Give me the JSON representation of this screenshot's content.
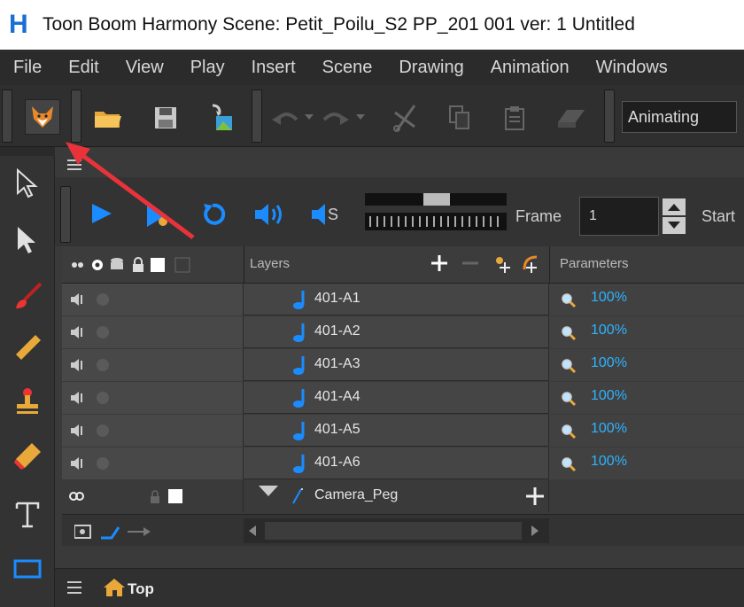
{
  "titlebar": {
    "app_icon": "H",
    "title": "Toon Boom Harmony Scene: Petit_Poilu_S2 PP_201 001 ver: 1 Untitled"
  },
  "menu": [
    "File",
    "Edit",
    "View",
    "Play",
    "Insert",
    "Scene",
    "Drawing",
    "Animation",
    "Windows"
  ],
  "toolbar": {
    "icons": [
      "fox-mascot-icon",
      "open-folder-icon",
      "save-icon",
      "import-image-icon",
      "undo-icon",
      "redo-icon",
      "cut-icon",
      "copy-icon",
      "paste-icon",
      "eraser-block-icon"
    ],
    "mode": "Animating"
  },
  "left_tools": [
    "select-arrow-icon",
    "contour-arrow-icon",
    "brush-icon",
    "pencil-icon",
    "stamp-icon",
    "eraser-icon",
    "text-icon",
    "rectangle-icon"
  ],
  "playbar": {
    "frame_label": "Frame",
    "frame_value": "1",
    "start_label": "Start",
    "sound_scrub_label": "S"
  },
  "grid": {
    "layers_header": "Layers",
    "parameters_header": "Parameters",
    "rows": [
      {
        "name": "401-A1",
        "param": "100%"
      },
      {
        "name": "401-A2",
        "param": "100%"
      },
      {
        "name": "401-A3",
        "param": "100%"
      },
      {
        "name": "401-A4",
        "param": "100%"
      },
      {
        "name": "401-A5",
        "param": "100%"
      },
      {
        "name": "401-A6",
        "param": "100%"
      }
    ],
    "camera_peg": "Camera_Peg"
  },
  "bottom": {
    "breadcrumb": "Top"
  },
  "colors": {
    "accent_blue": "#1a8cff",
    "param_blue": "#2fb3ff",
    "arrow_red": "#e8333a"
  }
}
